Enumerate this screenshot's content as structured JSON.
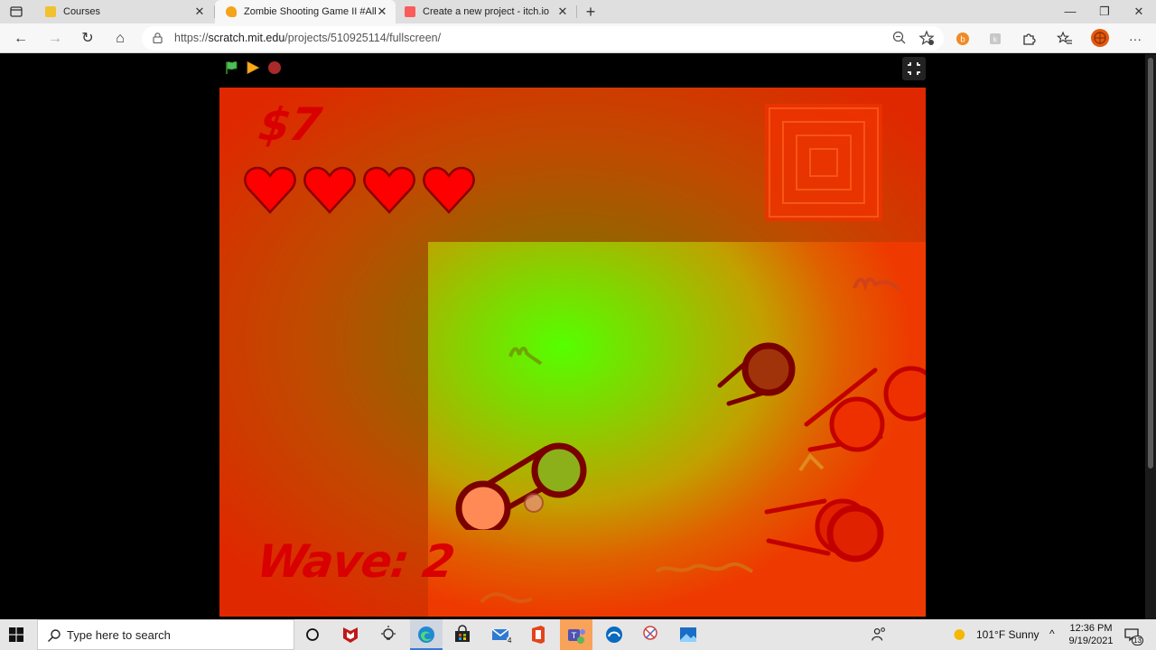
{
  "browser": {
    "tabs": [
      {
        "title": "Courses",
        "active": false,
        "favicon_color": "#f2c12e"
      },
      {
        "title": "Zombie Shooting Game II #All #",
        "active": true,
        "favicon_color": "#f5a31a"
      },
      {
        "title": "Create a new project - itch.io",
        "active": false,
        "favicon_color": "#fa5c5c"
      }
    ],
    "tab_close_glyph": "✕",
    "new_tab_glyph": "+",
    "window_controls": {
      "minimize": "—",
      "restore": "❐",
      "close": "✕"
    },
    "url": {
      "scheme": "https://",
      "host": "scratch.mit.edu",
      "path": "/projects/510925114/fullscreen/"
    },
    "nav": {
      "back": "←",
      "forward": "→",
      "refresh": "↻",
      "home": "⌂",
      "more": "···"
    }
  },
  "player": {
    "controls": [
      "green-flag-icon",
      "play-icon",
      "stop-icon",
      "exit-fullscreen-icon"
    ],
    "stage": {
      "money": "$7",
      "hearts": 4,
      "wave": "Wave: 2"
    }
  },
  "taskbar": {
    "search_placeholder": "Type here to search",
    "apps": [
      "cortana-icon",
      "mcafee-icon",
      "lightbulb-icon",
      "edge-icon",
      "store-icon",
      "mail-icon",
      "office-icon",
      "teams-icon",
      "webex-icon",
      "snip-icon",
      "photos-icon"
    ],
    "mail_badge": "4",
    "weather": "101°F  Sunny",
    "tray_chevron": "^",
    "time": "12:36 PM",
    "date": "9/19/2021",
    "notification_count": "13"
  },
  "colors": {
    "stage_red": "#e02800",
    "stage_green": "#55ff00",
    "hud_red": "#d80000",
    "zombie_dark": "#7a0000"
  }
}
